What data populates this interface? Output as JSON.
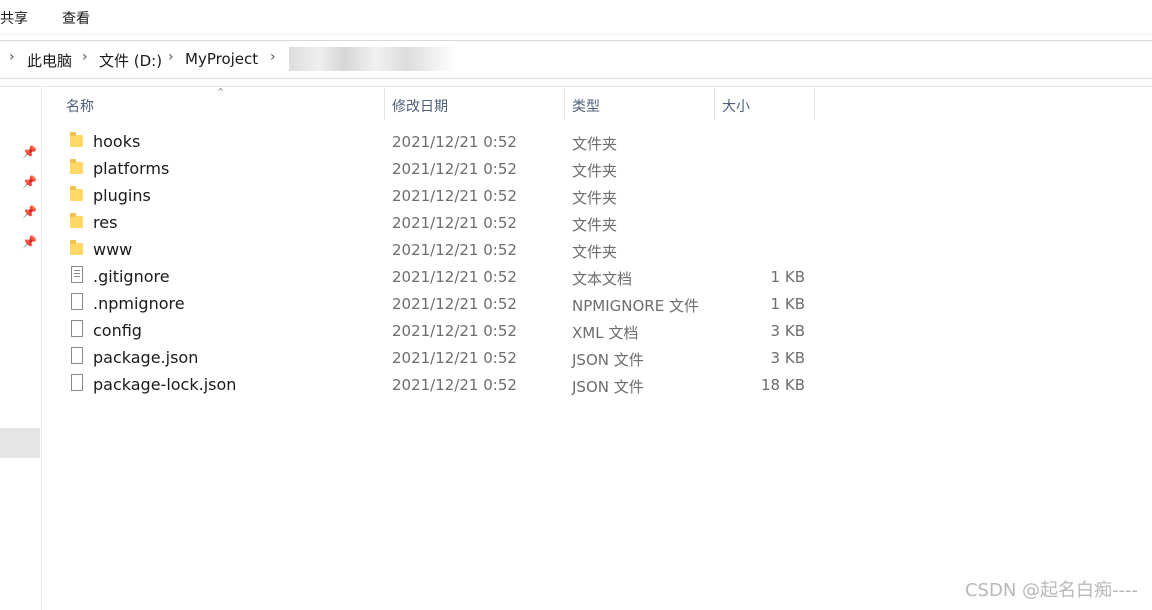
{
  "ribbon": {
    "tabs": [
      "共享",
      "查看"
    ]
  },
  "breadcrumb": {
    "items": [
      "此电脑",
      "文件 (D:)",
      "MyProject"
    ]
  },
  "columns": {
    "name": "名称",
    "modified": "修改日期",
    "type": "类型",
    "size": "大小"
  },
  "files": [
    {
      "name": "hooks",
      "date": "2021/12/21 0:52",
      "type": "文件夹",
      "size": "",
      "icon": "folder-icon"
    },
    {
      "name": "platforms",
      "date": "2021/12/21 0:52",
      "type": "文件夹",
      "size": "",
      "icon": "folder-icon"
    },
    {
      "name": "plugins",
      "date": "2021/12/21 0:52",
      "type": "文件夹",
      "size": "",
      "icon": "folder-icon"
    },
    {
      "name": "res",
      "date": "2021/12/21 0:52",
      "type": "文件夹",
      "size": "",
      "icon": "folder-icon"
    },
    {
      "name": "www",
      "date": "2021/12/21 0:52",
      "type": "文件夹",
      "size": "",
      "icon": "folder-icon"
    },
    {
      "name": ".gitignore",
      "date": "2021/12/21 0:52",
      "type": "文本文档",
      "size": "1 KB",
      "icon": "text-file-icon"
    },
    {
      "name": ".npmignore",
      "date": "2021/12/21 0:52",
      "type": "NPMIGNORE 文件",
      "size": "1 KB",
      "icon": "file-icon"
    },
    {
      "name": "config",
      "date": "2021/12/21 0:52",
      "type": "XML 文档",
      "size": "3 KB",
      "icon": "file-icon"
    },
    {
      "name": "package.json",
      "date": "2021/12/21 0:52",
      "type": "JSON 文件",
      "size": "3 KB",
      "icon": "file-icon"
    },
    {
      "name": "package-lock.json",
      "date": "2021/12/21 0:52",
      "type": "JSON 文件",
      "size": "18 KB",
      "icon": "file-icon"
    }
  ],
  "watermark": "CSDN @起名白痴----"
}
